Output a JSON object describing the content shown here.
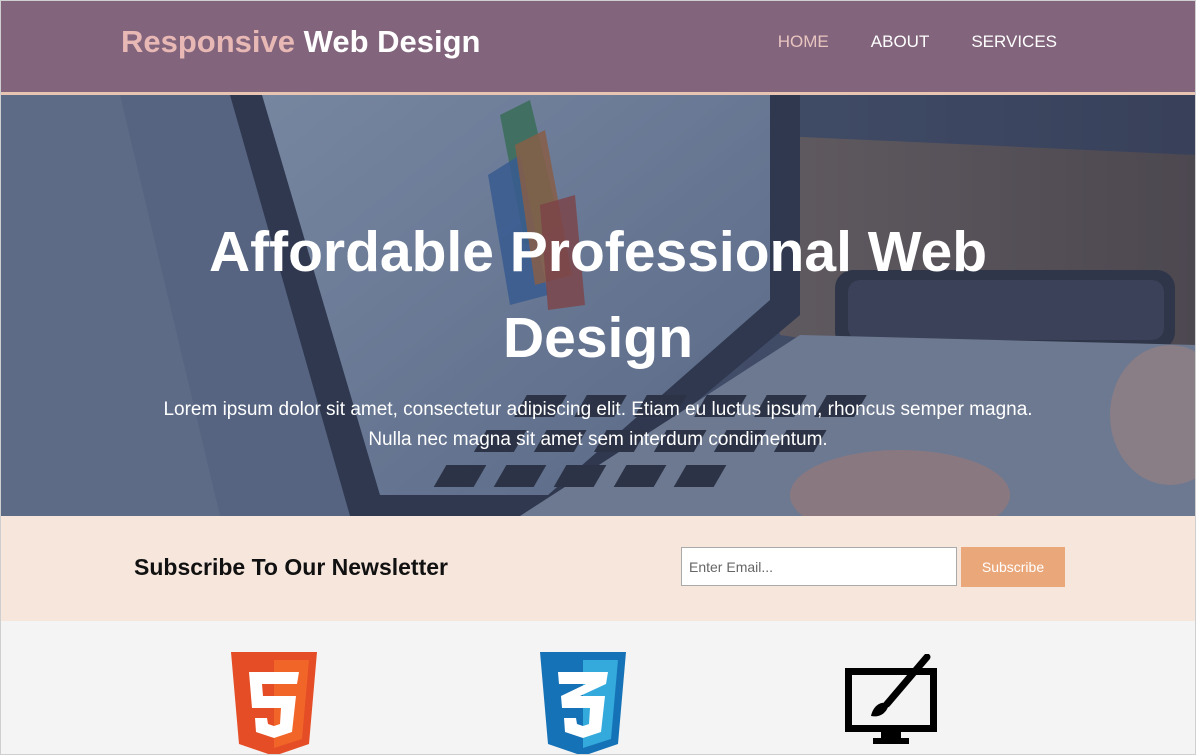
{
  "header": {
    "brand_highlight": "Responsive",
    "brand_rest": "Web Design",
    "nav": [
      {
        "label": "HOME",
        "current": true
      },
      {
        "label": "ABOUT",
        "current": false
      },
      {
        "label": "SERVICES",
        "current": false
      }
    ]
  },
  "showcase": {
    "title_line1": "Affordable Professional Web",
    "title_line2": "Design",
    "text": "Lorem ipsum dolor sit amet, consectetur adipiscing elit. Etiam eu luctus ipsum, rhoncus semper magna. Nulla nec magna sit amet sem interdum condimentum."
  },
  "newsletter": {
    "heading": "Subscribe To Our Newsletter",
    "email_placeholder": "Enter Email...",
    "email_value": "",
    "button_label": "Subscribe"
  },
  "boxes": {
    "icons": [
      "html5-icon",
      "css3-icon",
      "brush-monitor-icon"
    ]
  },
  "colors": {
    "header_bg": "#82657c",
    "brand_highlight": "#e8b8b5",
    "header_border": "#e8c4b2",
    "newsletter_bg": "#f7e6dc",
    "button_bg": "#eaa77a",
    "html5_orange": "#e44d26",
    "css3_blue": "#1572b6"
  }
}
